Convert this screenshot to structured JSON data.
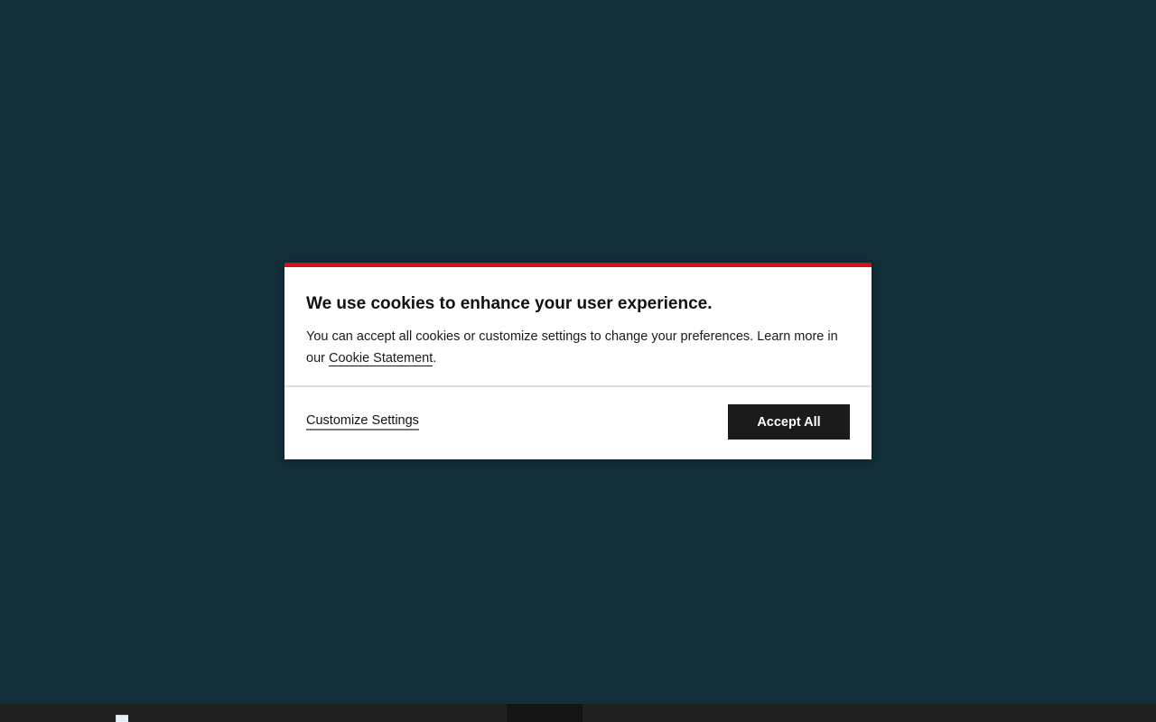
{
  "cookie_dialog": {
    "title": "We use cookies to enhance your user experience.",
    "text_before_link": "You can accept all cookies or customize settings to change your preferences. Learn more in our ",
    "link_label": "Cookie Statement",
    "text_after_link": ".",
    "customize_label": "Customize Settings",
    "accept_label": "Accept All"
  },
  "colors": {
    "backdrop": "#132f3a",
    "accent_top_border": "#d0111b",
    "button_background": "#1b1b1b",
    "bottom_bar": "#212121"
  },
  "icons": {
    "bottom_bar_image": "broken-image-icon"
  }
}
